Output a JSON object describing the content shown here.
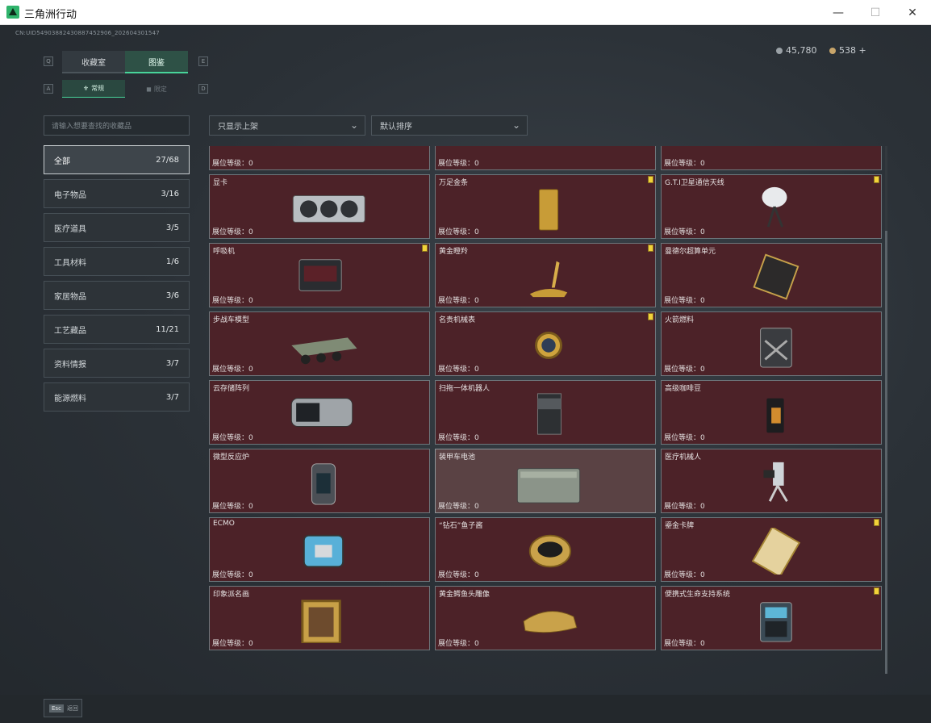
{
  "window": {
    "title": "三角洲行动"
  },
  "header": {
    "uid": "CN:UID5490388243088745290​6_202604301547",
    "currency1": "45,780",
    "currency2": "538 +"
  },
  "tabs": [
    {
      "label": "收藏室",
      "key": "Q"
    },
    {
      "label": "图鉴",
      "key": "E"
    }
  ],
  "subtabs": [
    {
      "label": "常规",
      "key": "A"
    },
    {
      "label": "限定",
      "key": "D"
    }
  ],
  "search": {
    "placeholder": "请输入想要查找的收藏品"
  },
  "filters": {
    "shelf": "只显示上架",
    "sort": "默认排序"
  },
  "categories": [
    {
      "label": "全部",
      "count": "27/68"
    },
    {
      "label": "电子物品",
      "count": "3/16"
    },
    {
      "label": "医疗道具",
      "count": "3/5"
    },
    {
      "label": "工具材料",
      "count": "1/6"
    },
    {
      "label": "家居物品",
      "count": "3/6"
    },
    {
      "label": "工艺藏品",
      "count": "11/21"
    },
    {
      "label": "资料情报",
      "count": "3/7"
    },
    {
      "label": "能源燃料",
      "count": "3/7"
    }
  ],
  "level_label": "展位等级：",
  "items": [
    {
      "name": "",
      "level": "0",
      "badge": false,
      "icon": "pocket-watch-icon"
    },
    {
      "name": "",
      "level": "0",
      "badge": false,
      "icon": "bust-icon"
    },
    {
      "name": "",
      "level": "0",
      "badge": false,
      "icon": "fossil-claw-icon"
    },
    {
      "name": "显卡",
      "level": "0",
      "badge": false,
      "icon": "gpu-icon"
    },
    {
      "name": "万足金条",
      "level": "0",
      "badge": true,
      "icon": "gold-bar-icon"
    },
    {
      "name": "G.T.I卫星通信天线",
      "level": "0",
      "badge": true,
      "icon": "satellite-dish-icon"
    },
    {
      "name": "呼吸机",
      "level": "0",
      "badge": true,
      "icon": "ventilator-icon"
    },
    {
      "name": "黄金瞪羚",
      "level": "0",
      "badge": true,
      "icon": "gold-gazelle-icon"
    },
    {
      "name": "曼德尔超算单元",
      "level": "0",
      "badge": false,
      "icon": "compute-unit-icon"
    },
    {
      "name": "步战车模型",
      "level": "0",
      "badge": false,
      "icon": "ifv-model-icon"
    },
    {
      "name": "名贵机械表",
      "level": "0",
      "badge": true,
      "icon": "gold-watch-icon"
    },
    {
      "name": "火箭燃料",
      "level": "0",
      "badge": false,
      "icon": "fuel-canister-icon"
    },
    {
      "name": "云存储阵列",
      "level": "0",
      "badge": false,
      "icon": "storage-array-icon"
    },
    {
      "name": "扫拖一体机器人",
      "level": "0",
      "badge": false,
      "icon": "robot-vacuum-icon"
    },
    {
      "name": "高级咖啡豆",
      "level": "0",
      "badge": false,
      "icon": "coffee-bag-icon"
    },
    {
      "name": "微型反应炉",
      "level": "0",
      "badge": false,
      "icon": "reactor-icon"
    },
    {
      "name": "装甲车电池",
      "level": "0",
      "badge": false,
      "icon": "battery-icon"
    },
    {
      "name": "医疗机械人",
      "level": "0",
      "badge": false,
      "icon": "medical-robot-icon"
    },
    {
      "name": "ECMO",
      "level": "0",
      "badge": false,
      "icon": "ecmo-icon"
    },
    {
      "name": "“钻石”鱼子酱",
      "level": "0",
      "badge": false,
      "icon": "caviar-tin-icon"
    },
    {
      "name": "鎏金卡牌",
      "level": "0",
      "badge": true,
      "icon": "gilded-card-icon"
    },
    {
      "name": "印象派名画",
      "level": "0",
      "badge": false,
      "icon": "painting-icon"
    },
    {
      "name": "黄金鳄鱼头雕像",
      "level": "0",
      "badge": false,
      "icon": "croc-head-icon"
    },
    {
      "name": "便携式生命支持系统",
      "level": "0",
      "badge": true,
      "icon": "life-support-icon"
    }
  ],
  "footer": {
    "esc_key": "Esc",
    "back_label": "返回"
  }
}
